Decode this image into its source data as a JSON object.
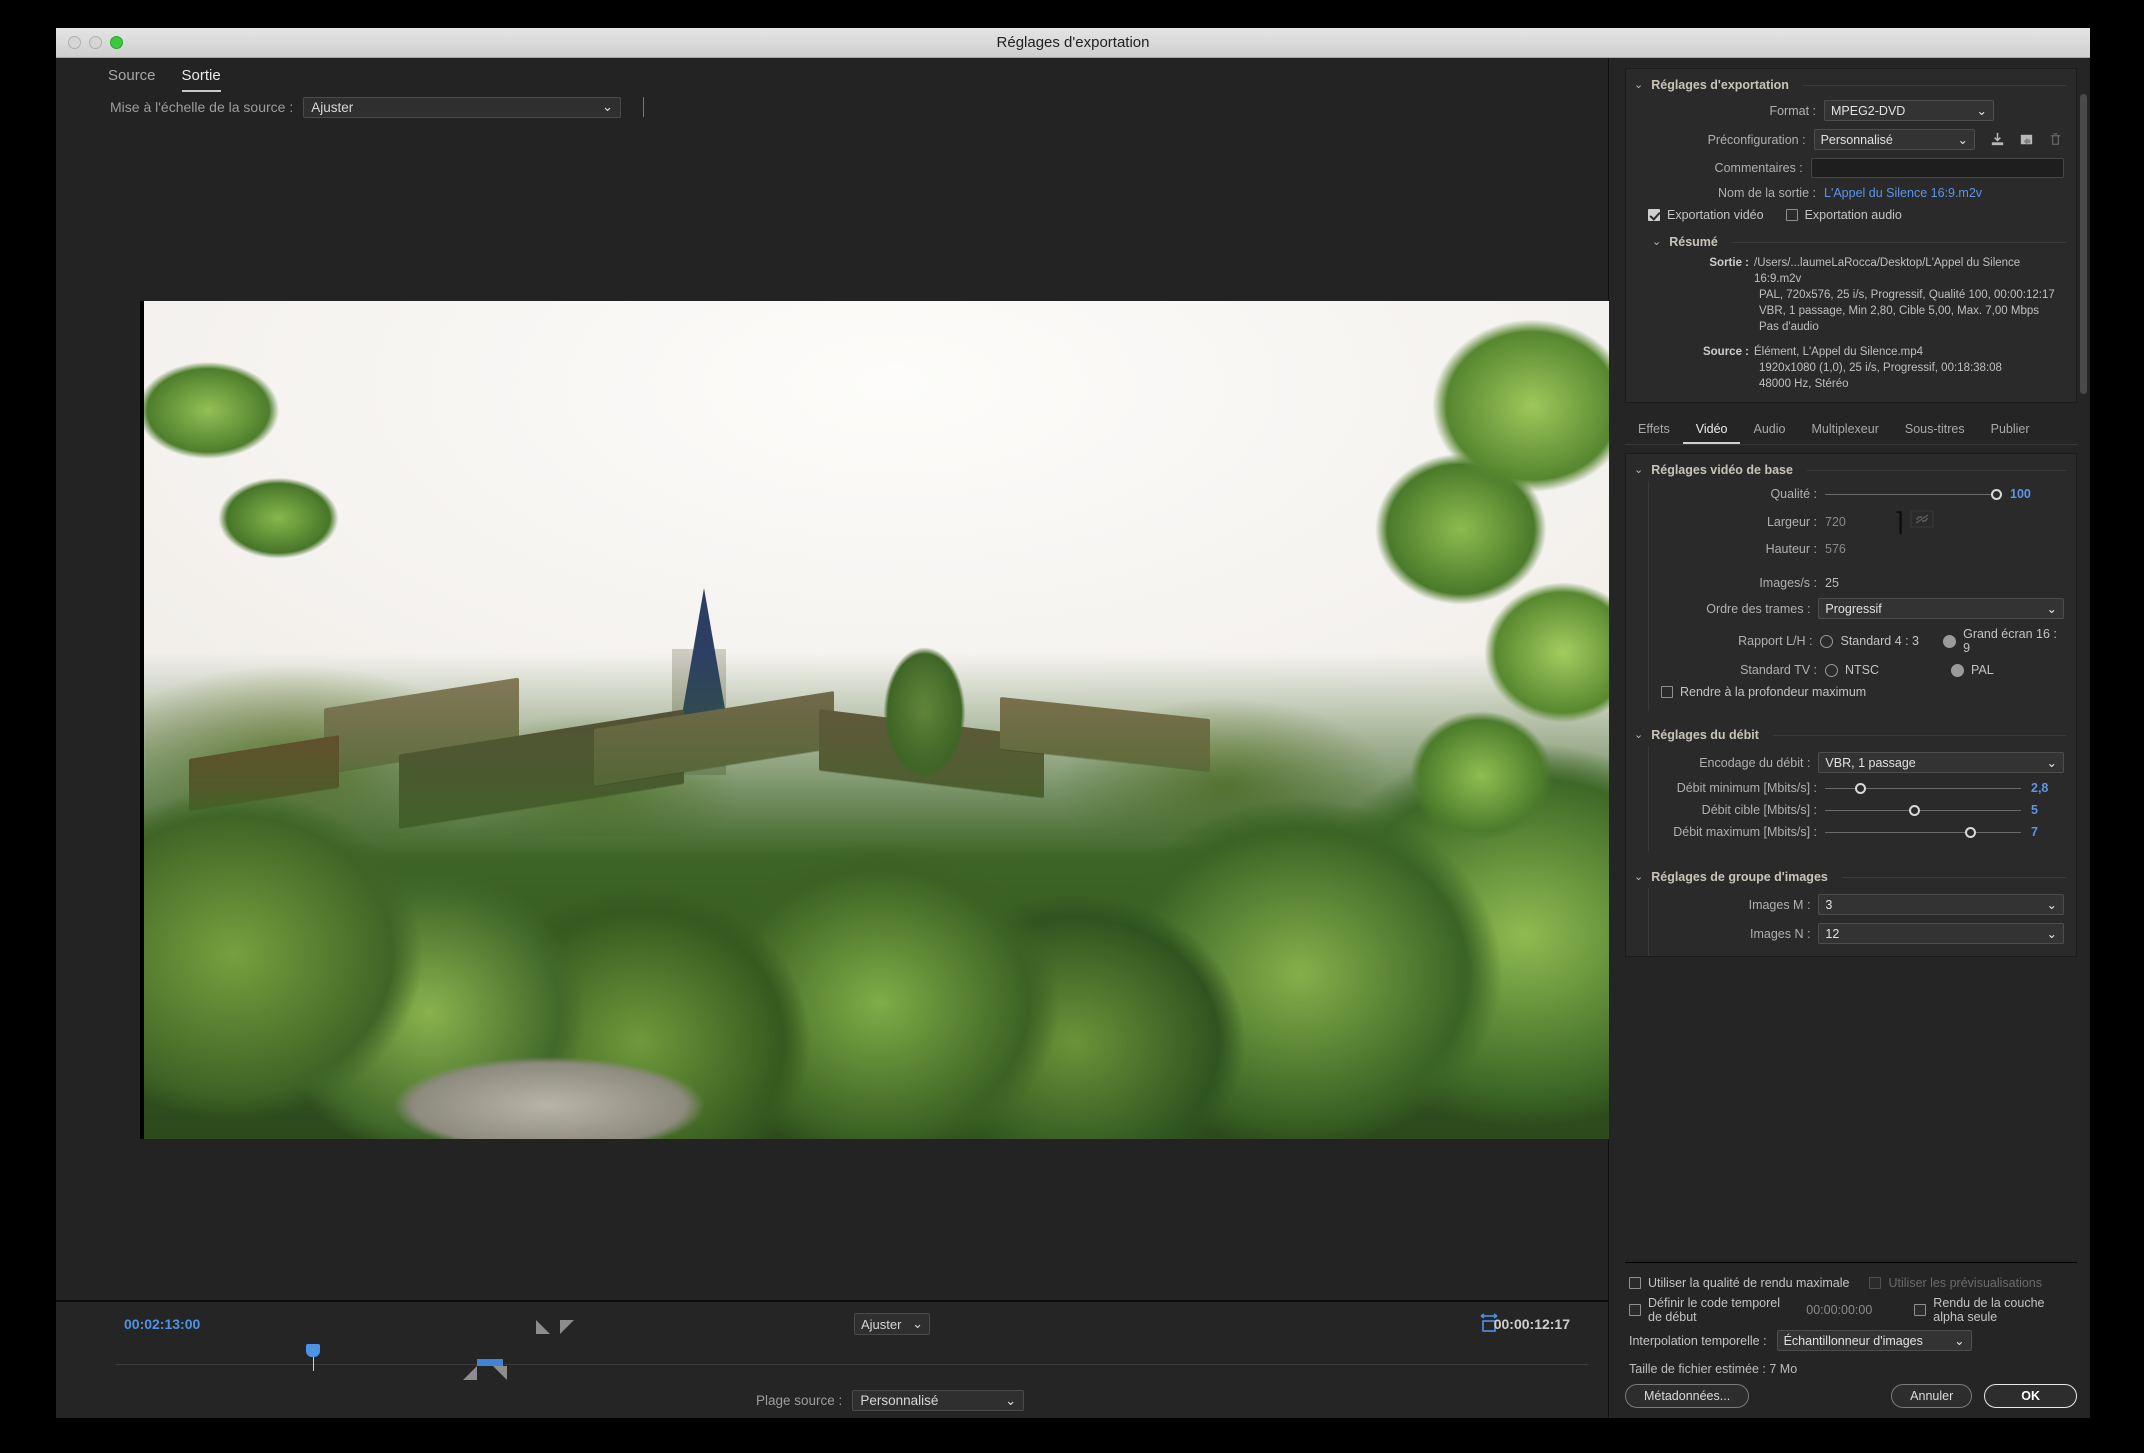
{
  "window": {
    "title": "Réglages d'exportation"
  },
  "left_panel": {
    "tabs": [
      {
        "label": "Source",
        "active": false
      },
      {
        "label": "Sortie",
        "active": true
      }
    ],
    "scale": {
      "label": "Mise à l'échelle de la source :",
      "value": "Ajuster"
    },
    "transport": {
      "current_timecode": "00:02:13:00",
      "duration_timecode": "00:00:12:17",
      "zoom_level": "Ajuster",
      "source_range_label": "Plage source :",
      "source_range_value": "Personnalisé"
    }
  },
  "export_settings": {
    "section_title": "Réglages d'exportation",
    "format_label": "Format :",
    "format_value": "MPEG2-DVD",
    "preset_label": "Préconfiguration :",
    "preset_value": "Personnalisé",
    "comments_label": "Commentaires :",
    "comments_value": "",
    "output_name_label": "Nom de la sortie :",
    "output_name_value": "L'Appel du Silence 16:9.m2v",
    "export_video_label": "Exportation vidéo",
    "export_video_checked": true,
    "export_audio_label": "Exportation audio",
    "export_audio_checked": false,
    "preset_icons": [
      "import-preset-icon",
      "export-preset-icon",
      "delete-preset-icon"
    ]
  },
  "summary": {
    "section_title": "Résumé",
    "output_key": "Sortie :",
    "output_lines": [
      "/Users/...laumeLaRocca/Desktop/L'Appel du Silence 16:9.m2v",
      "PAL, 720x576, 25 i/s, Progressif, Qualité  100, 00:00:12:17",
      "VBR, 1 passage, Min 2,80, Cible 5,00, Max. 7,00 Mbps",
      "Pas d'audio"
    ],
    "source_key": "Source :",
    "source_lines": [
      "Élément, L'Appel du Silence.mp4",
      "1920x1080 (1,0), 25 i/s, Progressif, 00:18:38:08",
      "48000 Hz, Stéréo"
    ]
  },
  "tabs": [
    {
      "label": "Effets",
      "active": false
    },
    {
      "label": "Vidéo",
      "active": true
    },
    {
      "label": "Audio",
      "active": false
    },
    {
      "label": "Multiplexeur",
      "active": false
    },
    {
      "label": "Sous-titres",
      "active": false
    },
    {
      "label": "Publier",
      "active": false
    }
  ],
  "basic_video": {
    "section_title": "Réglages vidéo de base",
    "quality_label": "Qualité :",
    "quality_value": "100",
    "quality_percent": 100,
    "width_label": "Largeur :",
    "width_value": "720",
    "height_label": "Hauteur :",
    "height_value": "576",
    "link_icon": "unlink-icon",
    "fps_label": "Images/s :",
    "fps_value": "25",
    "field_order_label": "Ordre des trames :",
    "field_order_value": "Progressif",
    "aspect_label": "Rapport L/H :",
    "aspect_options": [
      {
        "label": "Standard 4 : 3",
        "selected": false
      },
      {
        "label": "Grand écran 16 : 9",
        "selected": true
      }
    ],
    "tv_label": "Standard TV :",
    "tv_options": [
      {
        "label": "NTSC",
        "selected": false
      },
      {
        "label": "PAL",
        "selected": true
      }
    ],
    "max_depth_label": "Rendre à la profondeur maximum",
    "max_depth_checked": false
  },
  "bitrate": {
    "section_title": "Réglages du débit",
    "encoding_label": "Encodage du débit :",
    "encoding_value": "VBR, 1 passage",
    "sliders": [
      {
        "label": "Débit minimum [Mbits/s] :",
        "value": "2,8",
        "percent": 18
      },
      {
        "label": "Débit cible [Mbits/s] :",
        "value": "5",
        "percent": 46
      },
      {
        "label": "Débit maximum [Mbits/s] :",
        "value": "7",
        "percent": 72
      }
    ]
  },
  "gop": {
    "section_title": "Réglages de groupe d'images",
    "m_label": "Images M :",
    "m_value": "3",
    "n_label": "Images N :",
    "n_value": "12"
  },
  "render_options": {
    "max_quality_label": "Utiliser la qualité de rendu maximale",
    "max_quality_checked": false,
    "use_previews_label": "Utiliser les prévisualisations",
    "use_previews_checked": false,
    "use_previews_disabled": true,
    "start_timecode_label": "Définir le code temporel de début",
    "start_timecode_checked": false,
    "start_timecode_value": "00:00:00:00",
    "alpha_only_label": "Rendu de la couche alpha seule",
    "alpha_only_checked": false,
    "time_interpolation_label": "Interpolation temporelle :",
    "time_interpolation_value": "Échantillonneur d'images"
  },
  "footer": {
    "filesize_label": "Taille de fichier estimée :",
    "filesize_value": "7 Mo",
    "metadata_button": "Métadonnées...",
    "cancel_button": "Annuler",
    "ok_button": "OK"
  },
  "colors": {
    "accent_blue": "#5b94e8",
    "panel_bg": "#2a2a2a",
    "window_bg": "#252525"
  }
}
